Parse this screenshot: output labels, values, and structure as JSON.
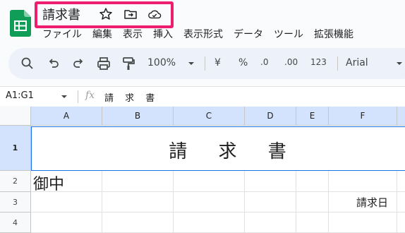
{
  "app": {
    "document_title": "請求書",
    "brand_color": "#0f9d58",
    "highlight_color": "#ee1d6f",
    "title_icons": [
      "star-icon",
      "move-to-folder-icon",
      "cloud-status-icon"
    ]
  },
  "menu": [
    "ファイル",
    "編集",
    "表示",
    "挿入",
    "表示形式",
    "データ",
    "ツール",
    "拡張機能"
  ],
  "toolbar": {
    "zoom": "100%",
    "currency": "¥",
    "percent": "%",
    "decrease_decimal": ".0",
    "increase_decimal": ".00",
    "number_format": "123",
    "font": "Arial"
  },
  "formula_bar": {
    "name_box": "A1:G1",
    "fx": "fx",
    "content": "請 求 書"
  },
  "columns": [
    "A",
    "B",
    "C",
    "D",
    "E",
    "F"
  ],
  "rows": [
    "1",
    "2",
    "3",
    "4"
  ],
  "cells": {
    "a1_merged": "請 求 書",
    "a2": "御中",
    "f3": "請求日"
  }
}
